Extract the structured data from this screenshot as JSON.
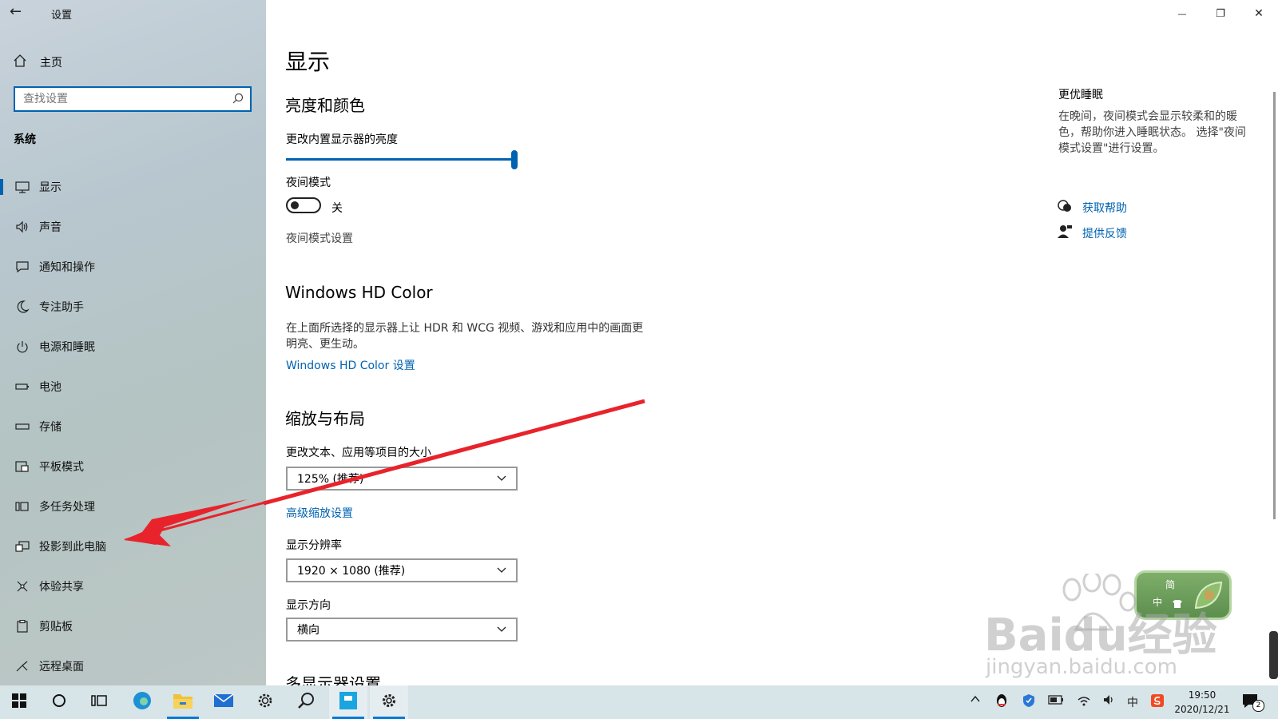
{
  "window": {
    "title": "设置",
    "minimize_glyph": "—",
    "restore_glyph": "❐",
    "close_glyph": "✕",
    "back_glyph": "←"
  },
  "sidebar": {
    "home_label": "主页",
    "search_placeholder": "查找设置",
    "section_title": "系统",
    "items": [
      {
        "label": "显示",
        "icon": "monitor-icon",
        "active": true
      },
      {
        "label": "声音",
        "icon": "speaker-icon"
      },
      {
        "label": "通知和操作",
        "icon": "notification-icon"
      },
      {
        "label": "专注助手",
        "icon": "moon-icon"
      },
      {
        "label": "电源和睡眠",
        "icon": "power-icon"
      },
      {
        "label": "电池",
        "icon": "battery-icon"
      },
      {
        "label": "存储",
        "icon": "storage-icon"
      },
      {
        "label": "平板模式",
        "icon": "tablet-icon"
      },
      {
        "label": "多任务处理",
        "icon": "multitask-icon"
      },
      {
        "label": "投影到此电脑",
        "icon": "project-icon"
      },
      {
        "label": "体验共享",
        "icon": "share-icon"
      },
      {
        "label": "剪贴板",
        "icon": "clipboard-icon"
      },
      {
        "label": "远程桌面",
        "icon": "remote-desktop-icon"
      }
    ]
  },
  "main": {
    "page_title": "显示",
    "brightness": {
      "heading": "亮度和颜色",
      "slider_label": "更改内置显示器的亮度",
      "value": 1.0
    },
    "night_mode": {
      "label": "夜间模式",
      "state": "关",
      "settings_link": "夜间模式设置"
    },
    "hdr": {
      "heading": "Windows HD Color",
      "description_line1": "在上面所选择的显示器上让 HDR 和 WCG 视频、游戏和应用中的画面更",
      "description_line2": "明亮、更生动。",
      "link": "Windows HD Color 设置"
    },
    "scale_layout": {
      "heading": "缩放与布局",
      "scale_label": "更改文本、应用等项目的大小",
      "scale_value": "125% (推荐)",
      "advanced_link": "高级缩放设置",
      "resolution_label": "显示分辨率",
      "resolution_value": "1920 × 1080 (推荐)",
      "orientation_label": "显示方向",
      "orientation_value": "横向"
    },
    "next_heading": "多显示器设置"
  },
  "right_panel": {
    "title": "更优睡眠",
    "desc_line1": "在晚间，夜间模式会显示较柔和的暖",
    "desc_line2": "色，帮助你进入睡眠状态。 选择\"夜间",
    "desc_line3": "模式设置\"进行设置。",
    "help_link": "获取帮助",
    "feedback_link": "提供反馈"
  },
  "ime_widget": {
    "line1": "简",
    "line2": "中"
  },
  "watermark": {
    "text": "Baidu经验",
    "url": "jingyan.baidu.com"
  },
  "taskbar": {
    "time": "19:50",
    "date": "2020/12/21",
    "ime_char": "中",
    "notification_count": "2"
  },
  "colors": {
    "accent": "#0063b1",
    "annotation_arrow": "#e8232b"
  }
}
